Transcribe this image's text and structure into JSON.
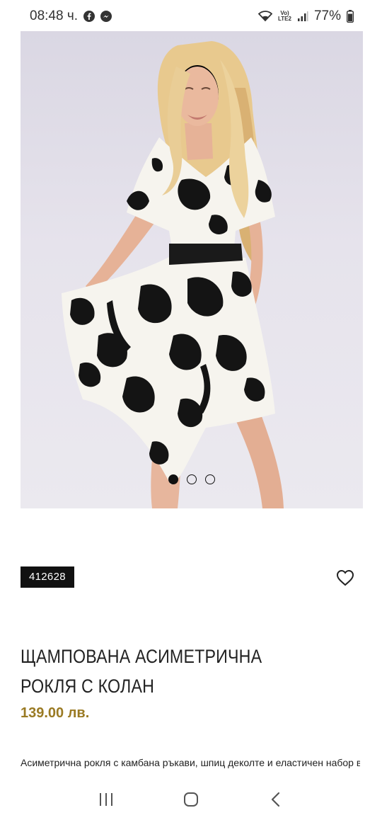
{
  "status_bar": {
    "time": "08:48 ч.",
    "battery": "77%",
    "network_top": "Vo)",
    "network_bottom": "LTE2",
    "icons": [
      "facebook-icon",
      "messenger-icon",
      "wifi-icon",
      "signal-icon",
      "battery-icon"
    ]
  },
  "product": {
    "image_alt": "woman in black and white floral asymmetric dress",
    "carousel": {
      "count": 3,
      "active": 0
    },
    "sku": "412628",
    "title": "ЩАМПОВАНА АСИМЕТРИЧНА РОКЛЯ С КОЛАН",
    "price": "139.00 лв.",
    "description": "Асиметрична рокля с камбана ръкави, шпиц деколте и еластичен набор в",
    "wishlist_icon": "heart-icon"
  },
  "nav_bar": {
    "icons": [
      "recent-apps-icon",
      "home-icon",
      "back-icon"
    ]
  },
  "colors": {
    "price": "#9a7a23",
    "badge_bg": "#111111",
    "image_bg": "#e3e0ea"
  }
}
